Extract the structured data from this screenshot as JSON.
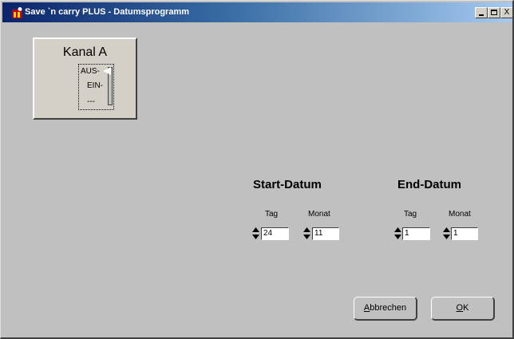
{
  "window": {
    "title": "Save `n carry PLUS - Datumsprogramm",
    "controls": {
      "minimize": "_",
      "maximize": "□",
      "close": "X"
    }
  },
  "channel_button": {
    "title": "Kanal A",
    "switch_positions": [
      "AUS",
      "EIN",
      "---"
    ],
    "switch_labels": {
      "aus": "AUS-",
      "ein": "EIN-",
      "off": "---"
    }
  },
  "start": {
    "heading": "Start-Datum",
    "day_label": "Tag",
    "month_label": "Monat",
    "day_value": "24",
    "month_value": "11"
  },
  "end": {
    "heading": "End-Datum",
    "day_label": "Tag",
    "month_label": "Monat",
    "day_value": "1",
    "month_value": "1"
  },
  "buttons": {
    "cancel_first": "A",
    "cancel_rest": "bbrechen",
    "ok_first": "O",
    "ok_rest": "K"
  },
  "icons": {
    "app": "app-icon",
    "spinner": "spinner-arrows-icon",
    "switch_knob": "triangle-left-icon"
  },
  "colors": {
    "titlebar_start": "#0a246a",
    "titlebar_end": "#a6caf0",
    "face": "#c0c0c0"
  }
}
